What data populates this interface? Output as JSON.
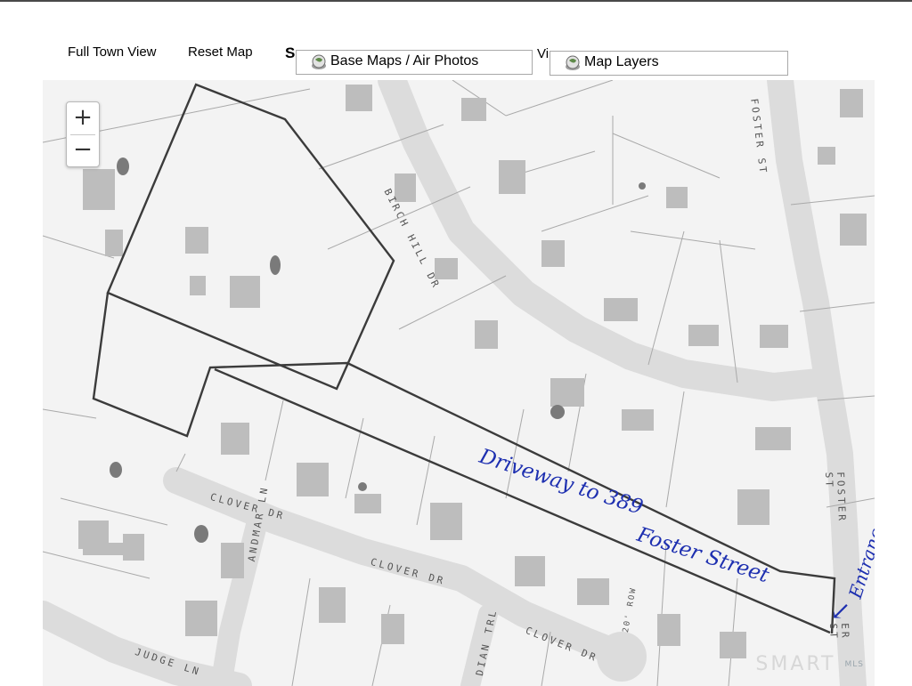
{
  "toolbar": {
    "full_town_view": "Full Town View",
    "reset_map": "Reset Map",
    "clipped_left": "S",
    "base_maps": "Base Maps / Air Photos",
    "clipped_mid": "Vi",
    "map_layers": "Map Layers"
  },
  "zoom": {
    "in": "+",
    "out": "−"
  },
  "streets": {
    "birch_hill": "BIRCH HILL DR",
    "foster_north": "FOSTER ST",
    "foster_south": "FOSTER ST",
    "foster_bottom": "ER ST",
    "clover_1": "CLOVER DR",
    "clover_2": "CLOVER DR",
    "clover_3": "CLOVER DR",
    "andmar": "ANDMAR LN",
    "judge": "JUDGE LN",
    "indian": "DIAN TRL",
    "row": "20' ROW"
  },
  "annotations": {
    "driveway_line1": "Driveway to 389",
    "driveway_line2": "Foster Street",
    "entrance": "Entrance",
    "arrow": "↙"
  },
  "logo": {
    "brand": "SMART",
    "suffix": "MLS"
  },
  "colors": {
    "ink": "#1d2fb0",
    "boundary": "#3b3b3b"
  }
}
